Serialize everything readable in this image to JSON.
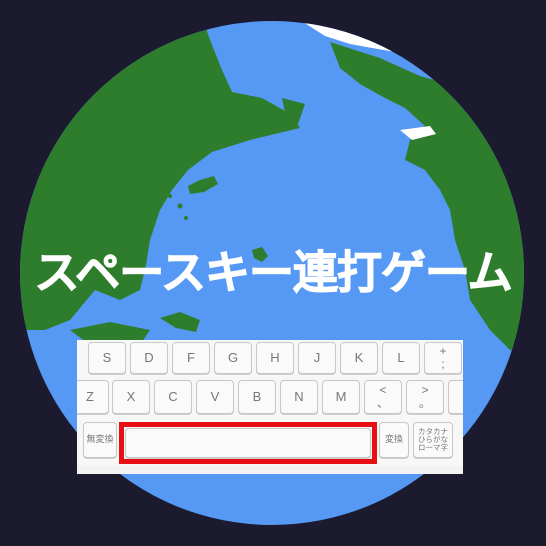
{
  "title": "スペースキー連打ゲーム",
  "colors": {
    "background": "#1b1a2e",
    "ocean": "#5599f4",
    "land": "#2e7d2c",
    "ice": "#ffffff",
    "highlight": "#e80f14"
  },
  "keyboard": {
    "row1": [
      "S",
      "D",
      "F",
      "G",
      "H",
      "J",
      "K",
      "L"
    ],
    "row1_right": [
      "+",
      ";"
    ],
    "row2": [
      "Z",
      "X",
      "C",
      "V",
      "B",
      "N",
      "M"
    ],
    "row2_comma": [
      "<",
      "、"
    ],
    "row2_period": [
      ">",
      "。"
    ],
    "row2_slash": [
      "?",
      "/"
    ],
    "muhenkan": "無変換",
    "space": "",
    "henkan": "変換",
    "kana": [
      "カタカナ",
      "ひらがな",
      "ローマ字"
    ]
  }
}
